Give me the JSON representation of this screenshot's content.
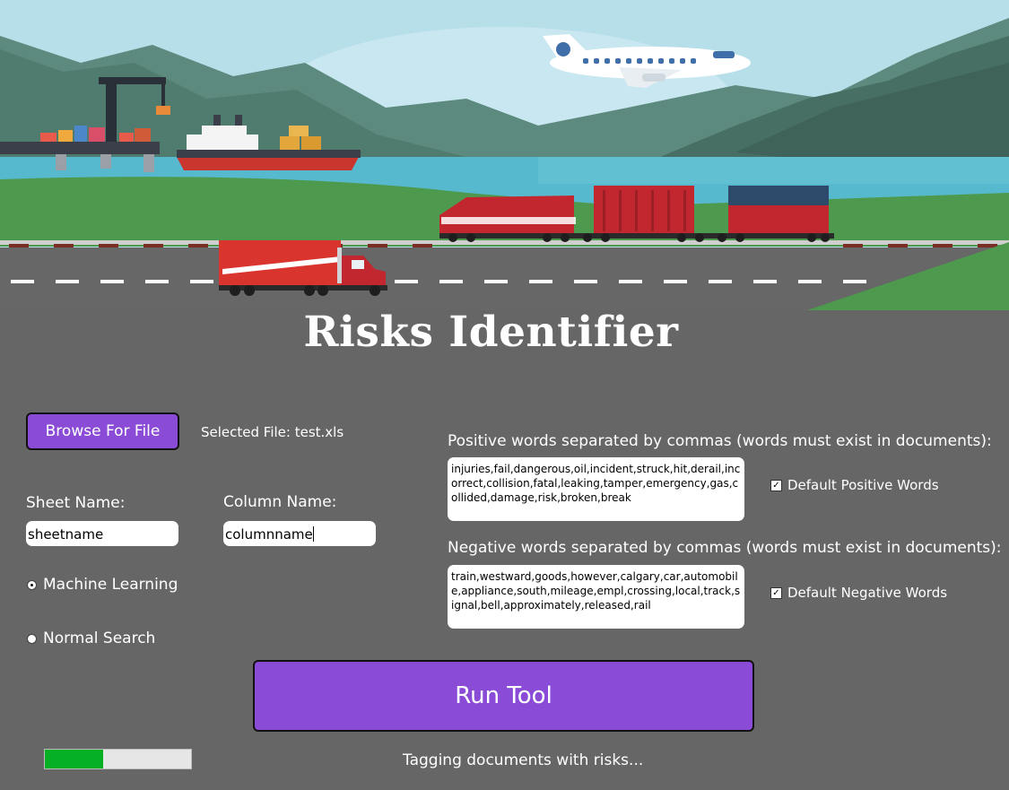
{
  "app": {
    "title": "Risks Identifier"
  },
  "file": {
    "browse_label": "Browse For File",
    "selected_text": "Selected File: test.xls"
  },
  "sheet": {
    "label": "Sheet Name:",
    "value": "sheetname"
  },
  "column": {
    "label": "Column Name:",
    "value": "columnname"
  },
  "mode": {
    "options": [
      {
        "label": "Machine Learning",
        "selected": true
      },
      {
        "label": "Normal Search",
        "selected": false
      }
    ]
  },
  "positive": {
    "label": "Positive words separated by commas (words must exist in documents):",
    "value": "injuries,fail,dangerous,oil,incident,struck,hit,derail,incorrect,collision,fatal,leaking,tamper,emergency,gas,collided,damage,risk,broken,break",
    "default_label": "Default Positive Words",
    "default_checked": true
  },
  "negative": {
    "label": "Negative words separated by commas (words must exist in documents):",
    "value": "train,westward,goods,however,calgary,car,automobile,appliance,south,mileage,empl,crossing,local,track,signal,bell,approximately,released,rail",
    "default_label": "Default Negative Words",
    "default_checked": true
  },
  "run": {
    "label": "Run Tool"
  },
  "progress": {
    "value": 0.4,
    "status": "Tagging documents with risks..."
  },
  "colors": {
    "accent": "#8a4bd6",
    "background": "#666666",
    "progress": "#06b025"
  }
}
